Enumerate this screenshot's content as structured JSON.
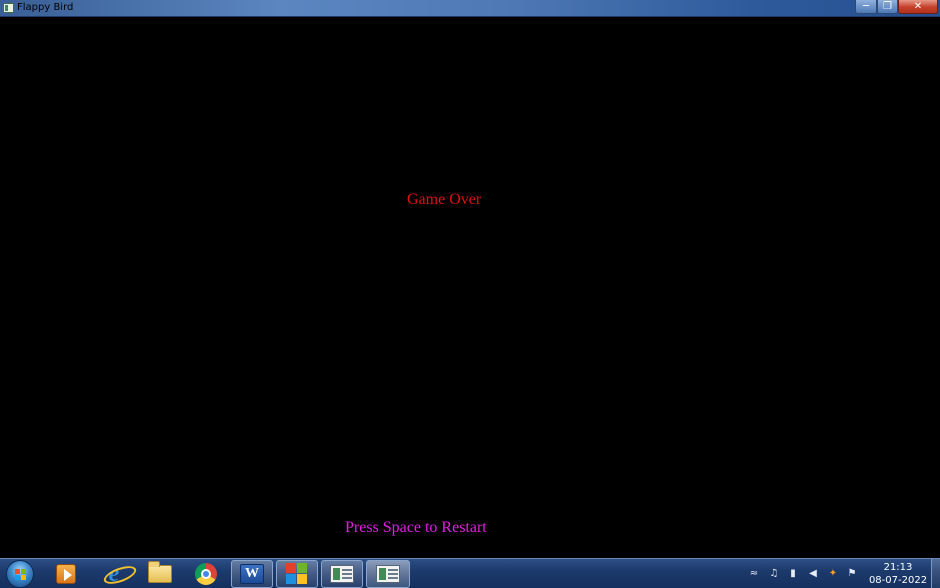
{
  "window": {
    "title": "Flappy Bird",
    "title_icon": "app-window-icon",
    "controls": {
      "minimize_glyph": "─",
      "maximize_glyph": "❐",
      "close_glyph": "✕"
    }
  },
  "game": {
    "status_text": "Game Over",
    "prompt_text": "Press Space to Restart",
    "colors": {
      "background": "#000000",
      "status": "#e01010",
      "prompt": "#e020e0"
    }
  },
  "taskbar": {
    "pinned": [
      {
        "icon": "windows-media-player-icon"
      },
      {
        "icon": "internet-explorer-icon",
        "glyph": "e"
      },
      {
        "icon": "file-explorer-icon"
      },
      {
        "icon": "chrome-icon"
      },
      {
        "icon": "microsoft-word-icon",
        "glyph": "W"
      },
      {
        "icon": "windows-logo-icon"
      },
      {
        "icon": "application-window-icon"
      },
      {
        "icon": "application-window-icon",
        "active": true
      }
    ],
    "tray": {
      "icons": [
        "network-icon",
        "music-icon",
        "battery-icon",
        "volume-icon",
        "power-icon",
        "action-center-flag-icon"
      ],
      "glyphs": [
        "≈",
        "♫",
        "▮",
        "◀",
        "✦",
        "⚑"
      ],
      "time": "21:13",
      "date": "08-07-2022"
    }
  }
}
